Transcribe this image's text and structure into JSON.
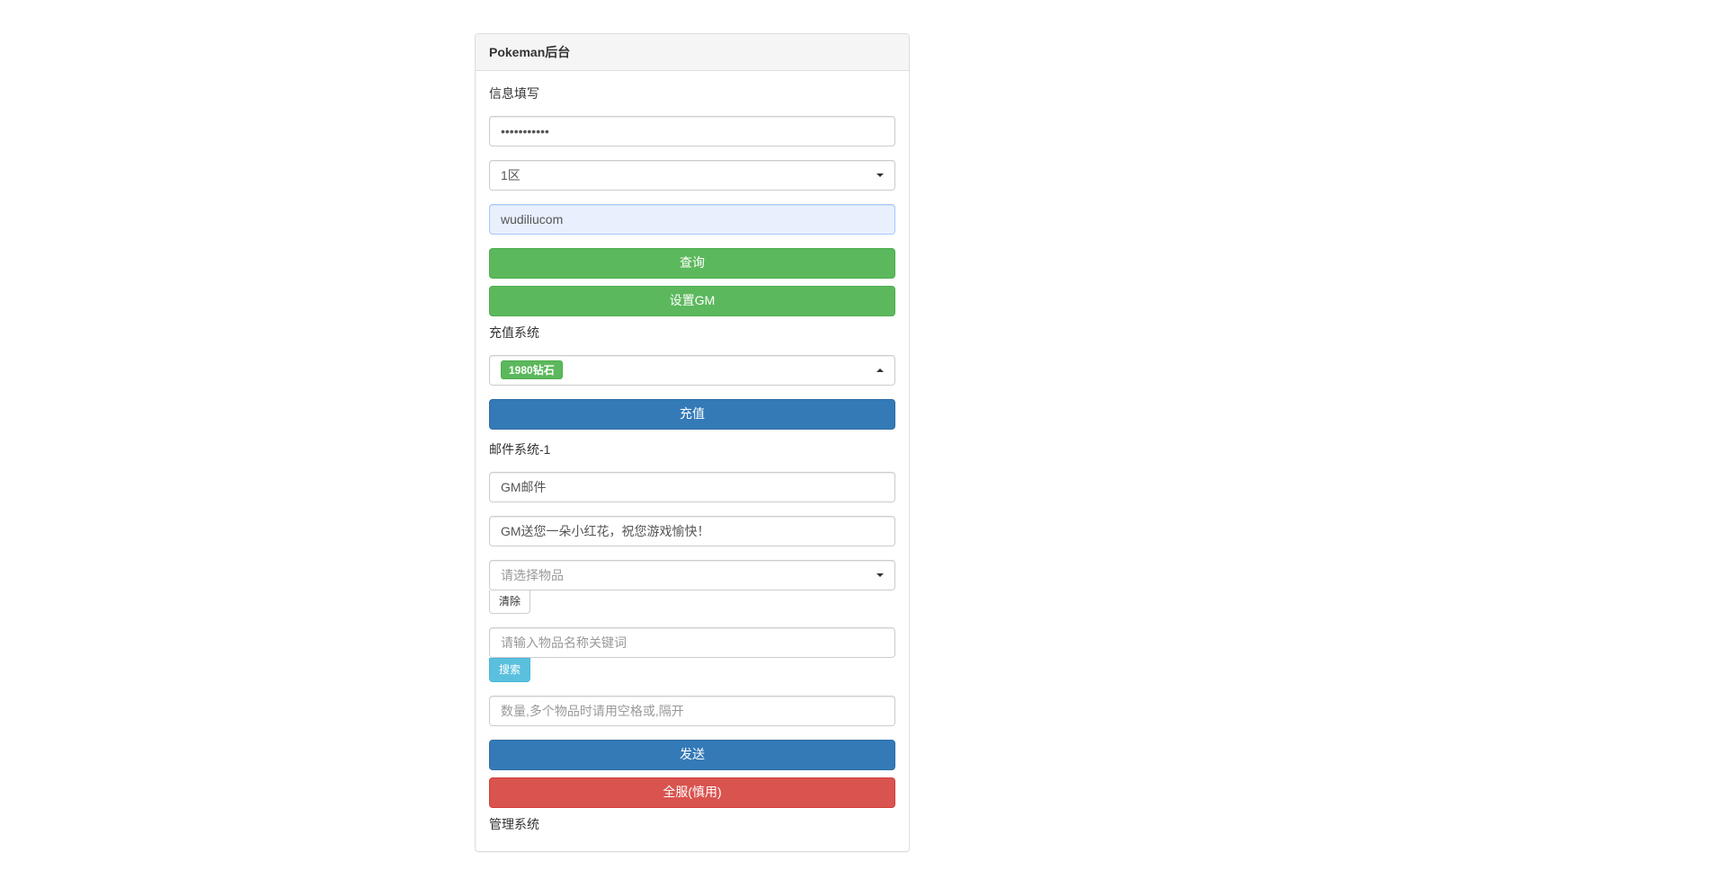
{
  "panel": {
    "title": "Pokeman后台"
  },
  "info": {
    "section_label": "信息填写",
    "password_value": "•••••••••••",
    "region_selected": "1区",
    "username_value": "wudiliucom",
    "query_button": "查询",
    "gm_button": "设置GM"
  },
  "recharge": {
    "section_label": "充值系统",
    "selected_option": "1980钻石",
    "recharge_button": "充值"
  },
  "mail": {
    "section_label": "邮件系统-1",
    "subject_value": "GM邮件",
    "body_value": "GM送您一朵小红花，祝您游戏愉快！",
    "item_select_placeholder": "请选择物品",
    "clear_button": "清除",
    "item_search_placeholder": "请输入物品名称关键词",
    "search_button": "搜索",
    "quantity_placeholder": "数量,多个物品时请用空格或,隔开",
    "send_button": "发送",
    "all_server_button": "全服(慎用)"
  },
  "manage": {
    "section_label": "管理系统"
  }
}
